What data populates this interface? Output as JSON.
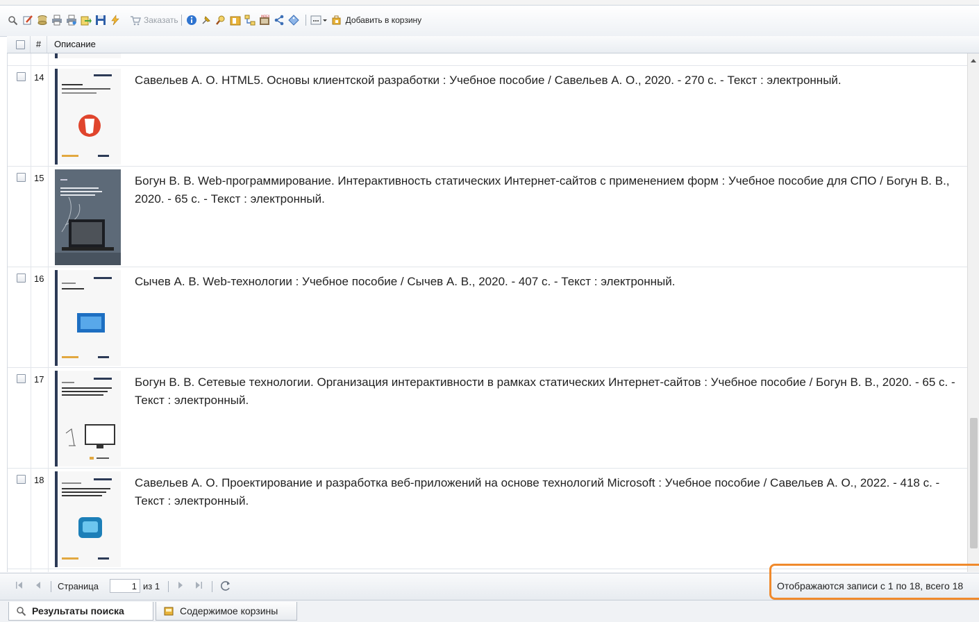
{
  "toolbar": {
    "order_label": "Заказать",
    "add_to_cart_label": "Добавить в корзину"
  },
  "grid": {
    "header": {
      "number_label": "#",
      "description_label": "Описание"
    },
    "rows": [
      {
        "number": "14",
        "description": "Савельев А. О. HTML5. Основы клиентской разработки : Учебное пособие / Савельев А. О., 2020. - 270 с. - Текст : электронный."
      },
      {
        "number": "15",
        "description": "Богун В. В. Web-программирование. Интерактивность статических Интернет-сайтов с применением форм : Учебное пособие для СПО / Богун В. В., 2020. - 65 с. - Текст : электронный."
      },
      {
        "number": "16",
        "description": "Сычев А. В. Web-технологии : Учебное пособие / Сычев А. В., 2020. - 407 с. - Текст : электронный."
      },
      {
        "number": "17",
        "description": "Богун В. В. Сетевые технологии. Организация интерактивности в рамках статических Интернет-сайтов : Учебное пособие / Богун В. В., 2020. - 65 с. - Текст : электронный."
      },
      {
        "number": "18",
        "description": "Савельев А. О. Проектирование и разработка веб-приложений на основе технологий Microsoft : Учебное пособие / Савельев А. О., 2022. - 418 с. - Текст : электронный."
      }
    ]
  },
  "pager": {
    "page_label": "Страница",
    "page_value": "1",
    "of_label": "из 1",
    "status_text": "Отображаются записи с 1 по 18, всего 18"
  },
  "tabs": {
    "search_results": "Результаты поиска",
    "cart_contents": "Содержимое корзины"
  },
  "colors": {
    "highlight": "#f08a2c",
    "cover_spine": "#2c3a56"
  }
}
